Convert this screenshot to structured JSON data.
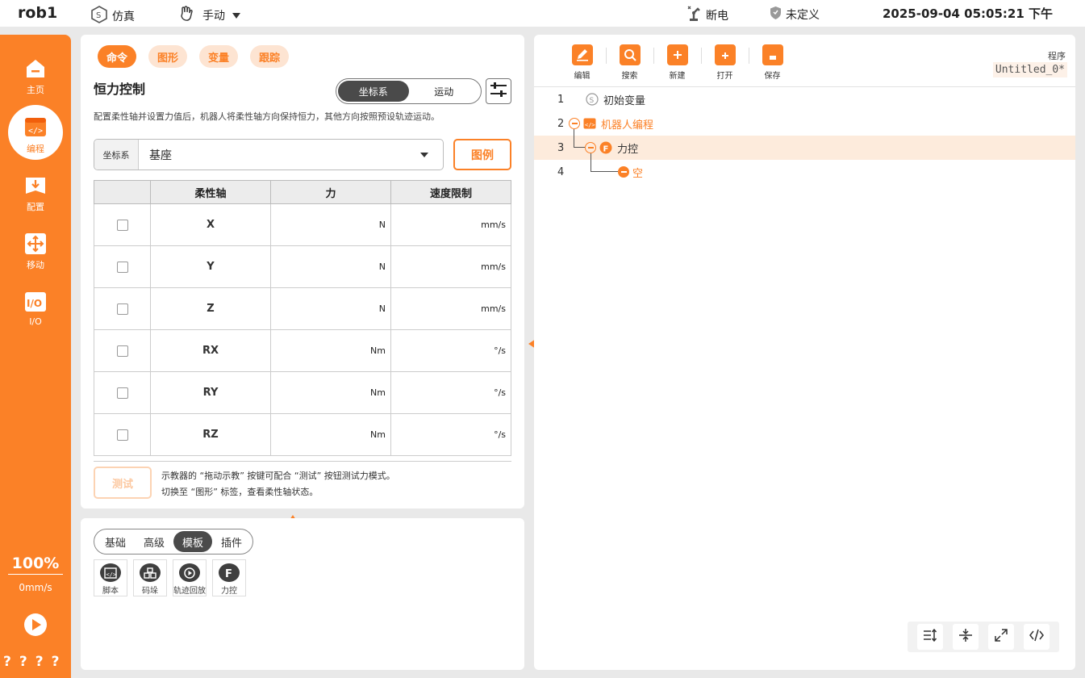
{
  "topbar": {
    "robot_name": "rob1",
    "sim_label": "仿真",
    "mode_label": "手动",
    "power_label": "断电",
    "safety_label": "未定义",
    "datetime": "2025-09-04 05:05:21 下午"
  },
  "sidebar": {
    "items": [
      {
        "label": "主页",
        "icon": "home-icon"
      },
      {
        "label": "编程",
        "icon": "code-icon"
      },
      {
        "label": "配置",
        "icon": "download-icon"
      },
      {
        "label": "移动",
        "icon": "move-icon"
      },
      {
        "label": "I/O",
        "icon": "io-icon"
      }
    ],
    "speed_pct": "100%",
    "speed_mm": "0mm/s",
    "bottom_marks": "????"
  },
  "panel": {
    "tabs": [
      "命令",
      "图形",
      "变量",
      "跟踪"
    ],
    "title": "恒力控制",
    "seg_options": [
      "坐标系",
      "运动"
    ],
    "description": "配置柔性轴并设置力值后，机器人将柔性轴方向保持恒力，其他方向按照预设轨迹运动。",
    "coord_label": "坐标系",
    "coord_value": "基座",
    "legend_button": "图例",
    "table_headers": [
      "",
      "柔性轴",
      "力",
      "速度限制"
    ],
    "rows": [
      {
        "axis": "X",
        "force_unit": "N",
        "speed_unit": "mm/s"
      },
      {
        "axis": "Y",
        "force_unit": "N",
        "speed_unit": "mm/s"
      },
      {
        "axis": "Z",
        "force_unit": "N",
        "speed_unit": "mm/s"
      },
      {
        "axis": "RX",
        "force_unit": "Nm",
        "speed_unit": "°/s"
      },
      {
        "axis": "RY",
        "force_unit": "Nm",
        "speed_unit": "°/s"
      },
      {
        "axis": "RZ",
        "force_unit": "Nm",
        "speed_unit": "°/s"
      }
    ],
    "test_button": "测试",
    "hint_line1": "示教器的 “拖动示教” 按键可配合 “测试” 按钮测试力模式。",
    "hint_line2": "切换至 “图形” 标签，查看柔性轴状态。"
  },
  "library": {
    "tabs": [
      "基础",
      "高级",
      "模板",
      "插件"
    ],
    "tools": [
      {
        "label": "脚本",
        "icon": "script-icon"
      },
      {
        "label": "码垛",
        "icon": "palletize-icon"
      },
      {
        "label": "轨迹回放",
        "icon": "replay-icon"
      },
      {
        "label": "力控",
        "icon": "force-icon"
      }
    ]
  },
  "program": {
    "toolbar": [
      "编辑",
      "搜索",
      "新建",
      "打开",
      "保存"
    ],
    "program_label": "程序",
    "program_name": "Untitled_0*",
    "lines": [
      {
        "num": "1",
        "label": "初始变量"
      },
      {
        "num": "2",
        "label": "机器人编程"
      },
      {
        "num": "3",
        "label": "力控"
      },
      {
        "num": "4",
        "label": "空"
      }
    ]
  },
  "colors": {
    "accent": "#fb8127",
    "dark": "#4a4a4a",
    "selected_row": "#fdebdc"
  }
}
